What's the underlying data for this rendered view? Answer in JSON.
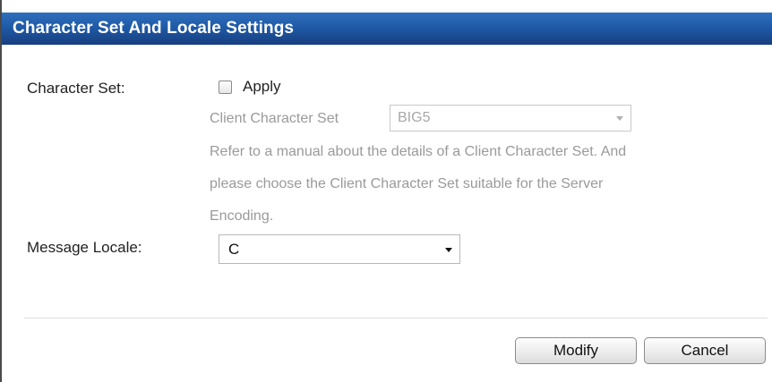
{
  "dialog": {
    "title": "Character Set And Locale Settings"
  },
  "character_set": {
    "label": "Character Set:",
    "apply_label": "Apply",
    "apply_checked": false,
    "client_charset_label": "Client Character Set",
    "client_charset_value": "BIG5",
    "help_line1": "Refer to a manual about the details of a Client Character Set. And",
    "help_line2": "please choose the Client Character Set suitable for the Server",
    "help_line3": "Encoding."
  },
  "message_locale": {
    "label": "Message Locale:",
    "value": "C"
  },
  "buttons": {
    "modify": "Modify",
    "cancel": "Cancel"
  },
  "colors": {
    "title_bar": "#1f5aa6",
    "disabled_text": "#9a9a9a"
  }
}
